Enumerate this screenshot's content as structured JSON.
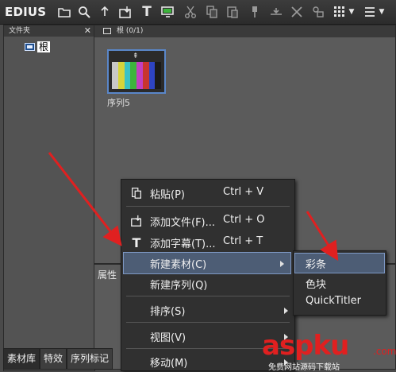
{
  "app": {
    "title": "EDIUS"
  },
  "toolbar": {
    "icons": [
      "folder-icon",
      "search-icon",
      "up-icon",
      "import-icon",
      "title-icon",
      "monitor-icon",
      "cut-icon",
      "copy-icon",
      "paste-icon",
      "pin-icon",
      "trim-icon",
      "delete-icon",
      "properties-icon",
      "view-grid-icon"
    ],
    "title_glyph": "T"
  },
  "folder_panel": {
    "title": "文件夹",
    "close": "✕",
    "root_label": "根"
  },
  "bin_panel": {
    "title": "根 (0/1)",
    "clip": {
      "label": "序列5",
      "top_glyph": "⇞",
      "bar_colors": [
        "#c8c8c8",
        "#d6d43a",
        "#39c2c4",
        "#3db43c",
        "#c23fc0",
        "#c8352e",
        "#2e44c4",
        "#1a1a1a"
      ]
    }
  },
  "property_panel": {
    "label": "属性"
  },
  "tabs": [
    "素材库",
    "特效",
    "序列标记"
  ],
  "context_menu": {
    "items": [
      {
        "label": "粘贴(P)",
        "shortcut": "Ctrl + V",
        "icon": "paste-icon",
        "glyph": "📋"
      },
      {
        "label": "添加文件(F)...",
        "shortcut": "Ctrl + O",
        "icon": "add-file-icon",
        "glyph": "⤓"
      },
      {
        "label": "添加字幕(T)...",
        "shortcut": "Ctrl + T",
        "icon": "title-icon",
        "glyph": "T"
      },
      {
        "label": "新建素材(C)",
        "shortcut": "",
        "icon": "",
        "glyph": ""
      },
      {
        "label": "新建序列(Q)",
        "shortcut": "",
        "icon": "",
        "glyph": ""
      },
      {
        "label": "排序(S)",
        "shortcut": "",
        "icon": "",
        "glyph": ""
      },
      {
        "label": "视图(V)",
        "shortcut": "",
        "icon": "",
        "glyph": ""
      },
      {
        "label": "移动(M)",
        "shortcut": "",
        "icon": "",
        "glyph": ""
      }
    ]
  },
  "submenu": {
    "items": [
      "彩条",
      "色块",
      "QuickTitler"
    ]
  },
  "watermark": {
    "main": "aspku",
    "suffix": ".com",
    "sub": "免费网站源码下载站"
  },
  "colors": {
    "annotation_arrow": "#e02020",
    "highlight": "#4d5d75"
  }
}
